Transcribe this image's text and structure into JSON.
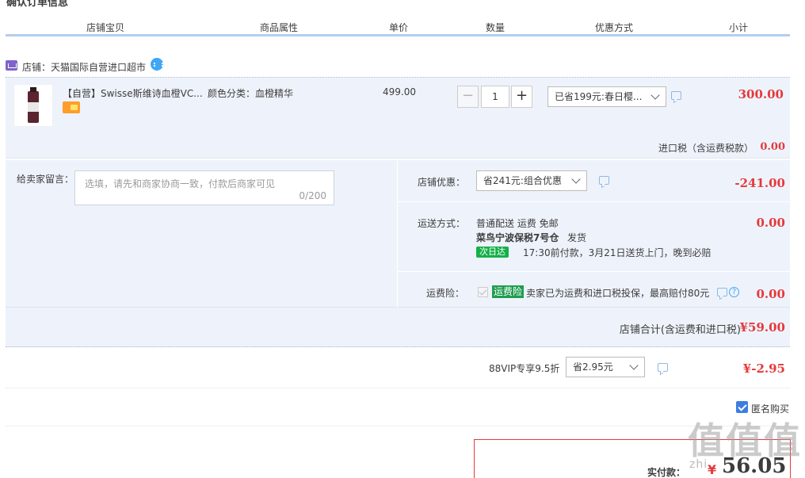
{
  "header": {
    "columns": [
      "店铺宝贝",
      "商品属性",
      "单价",
      "数量",
      "优惠方式",
      "小计"
    ]
  },
  "shop": {
    "label": "店铺：天猫国际自营进口超市"
  },
  "item": {
    "title": "【自营】Swisse斯维诗血橙VC...",
    "attribute": "颜色分类：血橙精华",
    "unit_price": "499.00",
    "quantity": "1",
    "minus": "−",
    "plus": "+",
    "discount_select": "已省199元:春日樱...",
    "subtotal": "300.00",
    "tax_label": "进口税（含运费税款）",
    "tax_value": "0.00"
  },
  "message": {
    "label": "给卖家留言：",
    "placeholder": "选填，请先和商家协商一致，付款后商家可见",
    "counter": "0/200"
  },
  "shop_discount": {
    "label": "店铺优惠：",
    "select": "省241元:组合优惠",
    "value": "-241.00"
  },
  "shipping": {
    "label": "运送方式：",
    "method": "普通配送 运费 免邮",
    "warehouse": "菜鸟宁波保税7号仓",
    "dispatch": "发货",
    "badge": "次日达",
    "note": "17:30前付款，3月21日送货上门，晚到必赔",
    "value": "0.00"
  },
  "insurance": {
    "label": "运费险：",
    "badge": "运费险",
    "text": "卖家已为运费和进口税投保，最高赔付80元",
    "value": "0.00"
  },
  "shop_total": {
    "label": "店铺合计(含运费和进口税)",
    "value": "¥59.00"
  },
  "vip": {
    "label": "88VIP专享9.5折",
    "select": "省2.95元",
    "value": "¥-2.95"
  },
  "anonymous": {
    "label": "匿名购买"
  },
  "pay": {
    "label": "实付款：",
    "currency": "¥",
    "amount": "56.05"
  },
  "watermark": {
    "text": "值值值",
    "sub": "zhi"
  },
  "colors": {
    "accent_red": "#e4393c",
    "header_rule": "#b3cdee",
    "row_bg": "#eef3fb",
    "green_badge": "#15b048"
  }
}
